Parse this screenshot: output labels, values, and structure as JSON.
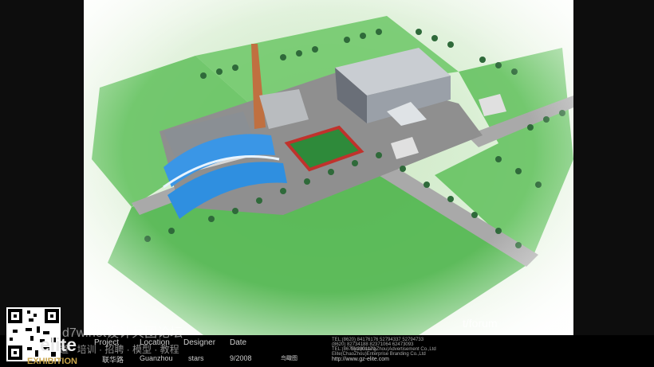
{
  "scene": {
    "description_label": "",
    "colors": {
      "grass": "#6fc26a",
      "road": "#9a9a9a",
      "roof_blue": "#2f8fe0",
      "court": "#2e8a3a",
      "court_border": "#c0322c",
      "chimney": "#c07040"
    }
  },
  "info_block": {
    "fields": [
      {
        "header": "Project",
        "value": "联华路"
      },
      {
        "header": "Location",
        "value": "Guanzhou"
      },
      {
        "header": "Designer",
        "value": "stars"
      },
      {
        "header": "Date",
        "value": "9/2008"
      }
    ],
    "view_label": "鸟瞰图",
    "company_lines": [
      "TEL:(8620) 84176176  52794337  52794733",
      "(8620) 82734188  82371064  62473093",
      "TEL:(8679) 2301170",
      "Elite(GuangZhou)Advertisement Co.,Ltd",
      "Elite(ChaoZhou)Enterprise Branding Co.,Ltd"
    ],
    "url": "http://www.gz-elite.com"
  },
  "logo": {
    "name": "elite",
    "sub": "EXHIBITION"
  },
  "watermark": {
    "line1": "d7w.net设计兵团论坛",
    "line2": "道 · 培训 · 招聘 · 模型 · 教程",
    "forum": "t/forum"
  }
}
